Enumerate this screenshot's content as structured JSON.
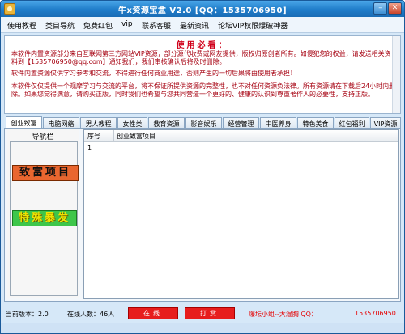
{
  "window": {
    "title": "牛x资源宝盒 V2.0 [QQ：1535706950]",
    "min_glyph": "–",
    "close_glyph": "✕"
  },
  "menu": [
    "使用教程",
    "类目导航",
    "免费红包",
    "vip",
    "联系客服",
    "最新资讯",
    "论坛VIP权限爆破神器"
  ],
  "notice": {
    "title": "使用必看：",
    "p1": "本软件内置资源部分来自互联网第三方网站VIP资源，部分源代收费或网友提供，版权归原创者所有。如侵犯您的权益，请发送相关资料到【1535706950@qq.com】通知我们，我们审核确认后将及时删除。",
    "p2": "软件内置资源仅供学习参考和交流，不得进行任何商业用途，否则产生的一切后果将由使用者承担！",
    "p3": "本软件仅仅提供一个观摩学习与交流的平台，将不保证所提供资源的完整性，也不对任何资源负法律。所有资源请在下载后24小时内删除。如果您觉得满意，请购买正版，同时我们也希望与您共同营造一个更好的、健康的认识到尊重著作人的必要性，支持正版。"
  },
  "tabs": [
    "创业致富",
    "电脑网络",
    "男人教程",
    "女性类",
    "教育资源",
    "影音娱乐",
    "经营管理",
    "中医养身",
    "特色美食",
    "红包福利",
    "VIP资源"
  ],
  "nav": {
    "title": "导航栏",
    "btn1": "致富项目",
    "btn2": "特殊暴发"
  },
  "list": {
    "col_index": "序号",
    "col_title": "创业致富项目",
    "rows": [
      {
        "index": "1",
        "title": ""
      }
    ]
  },
  "status": {
    "version": "当前版本：2.0",
    "online": "在线人数：46人",
    "btn_left": "在线",
    "btn_right": "打赏",
    "forum": "爆坛小组--大湿胸 QQ：",
    "qq": "1535706950"
  },
  "colors": {
    "title_bar": "#1f7cc9",
    "notice_red": "#a60010",
    "nav_btn_1": "#e9662f",
    "nav_btn_2": "#3ec64a",
    "status_btn": "#e71d1d"
  }
}
